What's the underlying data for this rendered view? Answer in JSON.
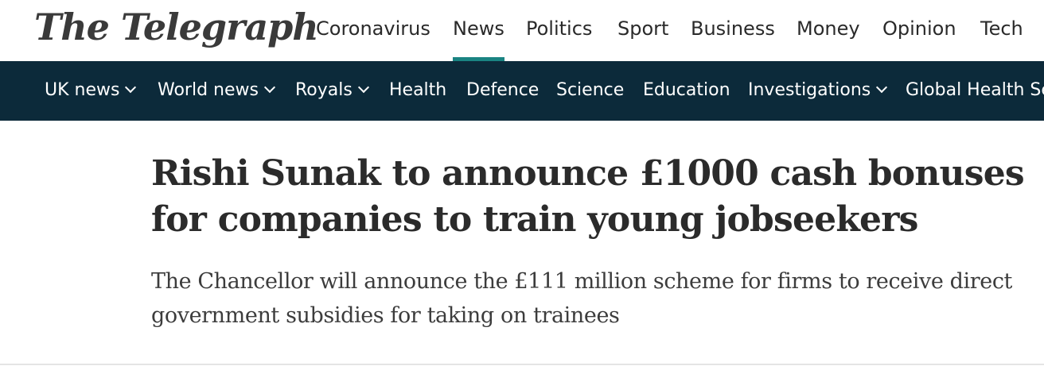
{
  "brand": {
    "logo_text": "The Telegraph"
  },
  "main_nav": {
    "items": [
      "Coronavirus",
      "News",
      "Politics",
      "Sport",
      "Business",
      "Money",
      "Opinion",
      "Tech"
    ],
    "active": "News",
    "accent_color": "#1a8482"
  },
  "sub_nav": {
    "background_color": "#0c2a3a",
    "items": [
      {
        "label": "UK news",
        "dropdown": true
      },
      {
        "label": "World news",
        "dropdown": true
      },
      {
        "label": "Royals",
        "dropdown": true
      },
      {
        "label": "Health",
        "dropdown": false
      },
      {
        "label": "Defence",
        "dropdown": false
      },
      {
        "label": "Science",
        "dropdown": false
      },
      {
        "label": "Education",
        "dropdown": false
      },
      {
        "label": "Investigations",
        "dropdown": true
      },
      {
        "label": "Global Health Se",
        "dropdown": false
      }
    ]
  },
  "article": {
    "headline": "Rishi Sunak to announce £1000 cash bonuses for companies to train young jobseekers",
    "standfirst": "The Chancellor will announce the £111 million scheme for firms to receive direct government subsidies for taking on trainees"
  }
}
